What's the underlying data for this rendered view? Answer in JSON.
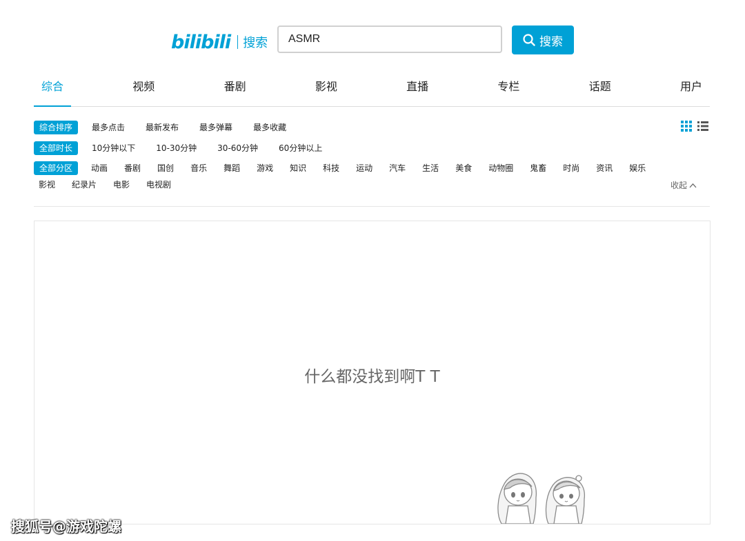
{
  "header": {
    "logo_mark": "bilibili",
    "logo_text": "搜索",
    "search_value": "ASMR",
    "search_button_label": "搜索"
  },
  "tabs": [
    {
      "label": "综合",
      "active": true
    },
    {
      "label": "视频"
    },
    {
      "label": "番剧"
    },
    {
      "label": "影视"
    },
    {
      "label": "直播"
    },
    {
      "label": "专栏"
    },
    {
      "label": "话题"
    },
    {
      "label": "用户"
    }
  ],
  "filters": {
    "sort": {
      "selected": "综合排序",
      "options": [
        "最多点击",
        "最新发布",
        "最多弹幕",
        "最多收藏"
      ]
    },
    "duration": {
      "selected": "全部时长",
      "options": [
        "10分钟以下",
        "10-30分钟",
        "30-60分钟",
        "60分钟以上"
      ]
    },
    "zone": {
      "selected": "全部分区",
      "options": [
        "动画",
        "番剧",
        "国创",
        "音乐",
        "舞蹈",
        "游戏",
        "知识",
        "科技",
        "运动",
        "汽车",
        "生活",
        "美食",
        "动物圈",
        "鬼畜",
        "时尚",
        "资讯",
        "娱乐",
        "影视",
        "纪录片",
        "电影",
        "电视剧"
      ]
    },
    "collapse_label": "收起"
  },
  "results": {
    "empty_message": "什么都没找到啊T T"
  },
  "watermark": "搜狐号@游戏陀螺",
  "colors": {
    "accent": "#00a1d6"
  },
  "icons": {
    "search": "search-icon",
    "grid": "grid-view-icon",
    "list": "list-view-icon",
    "chevron": "chevron-up-icon"
  }
}
